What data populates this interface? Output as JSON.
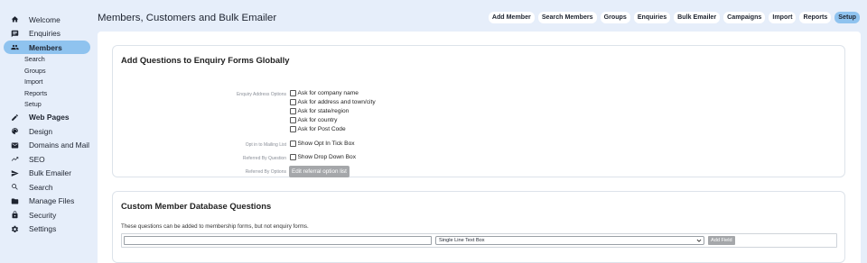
{
  "sidebar": {
    "items": [
      {
        "label": "Welcome",
        "icon": "home-icon"
      },
      {
        "label": "Enquiries",
        "icon": "message-icon"
      },
      {
        "label": "Members",
        "icon": "people-icon"
      },
      {
        "label": "Web Pages",
        "icon": "pencil-icon"
      },
      {
        "label": "Design",
        "icon": "palette-icon"
      },
      {
        "label": "Domains and Mail",
        "icon": "mail-icon"
      },
      {
        "label": "SEO",
        "icon": "trending-up-icon"
      },
      {
        "label": "Bulk Emailer",
        "icon": "send-icon"
      },
      {
        "label": "Search",
        "icon": "search-icon"
      },
      {
        "label": "Manage Files",
        "icon": "folder-icon"
      },
      {
        "label": "Security",
        "icon": "lock-icon"
      },
      {
        "label": "Settings",
        "icon": "gear-icon"
      }
    ],
    "members_sub": [
      "Search",
      "Groups",
      "Import",
      "Reports",
      "Setup"
    ]
  },
  "header": {
    "title": "Members, Customers and Bulk Emailer",
    "nav": [
      "Add Member",
      "Search Members",
      "Groups",
      "Enquiries",
      "Bulk Emailer",
      "Campaigns",
      "Import",
      "Reports",
      "Setup"
    ],
    "active_nav": "Setup"
  },
  "enquiry_card": {
    "title": "Add Questions to Enquiry Forms Globally",
    "address_label": "Enquiry Address Options",
    "address_options": [
      "Ask for company name",
      "Ask for address and town/city",
      "Ask for state/region",
      "Ask for country",
      "Ask for Post Code"
    ],
    "mailing_label": "Opt in to Mailing List",
    "mailing_option": "Show Opt In Tick Box",
    "referred_label": "Referred By Question",
    "referred_option": "Show Drop Down Box",
    "referred_options_label": "Referred By Options",
    "edit_referral_button": "Edit referral option list"
  },
  "custom_card": {
    "title": "Custom Member Database Questions",
    "description": "These questions can be added to membership forms, but not enquiry forms.",
    "question_input_value": "",
    "field_type_selected": "Single Line Text Box",
    "add_field_button": "Add Field"
  },
  "colors": {
    "background": "#e6eefa",
    "accent": "#8fc3ef",
    "button_grey": "#a5a7aa"
  }
}
